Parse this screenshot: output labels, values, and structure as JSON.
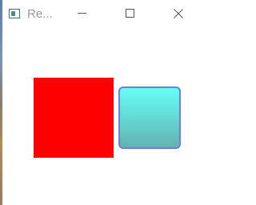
{
  "window": {
    "title": "Re...",
    "app_icon": "app-window-icon",
    "controls": {
      "minimize_icon": "minimize-icon",
      "maximize_icon": "maximize-icon",
      "close_icon": "close-icon"
    }
  },
  "colors": {
    "square_fill": "#ff0000",
    "button_gradient_top": "#66fef6",
    "button_gradient_bottom": "#63b3b0",
    "button_border": "#6b7fe6"
  }
}
